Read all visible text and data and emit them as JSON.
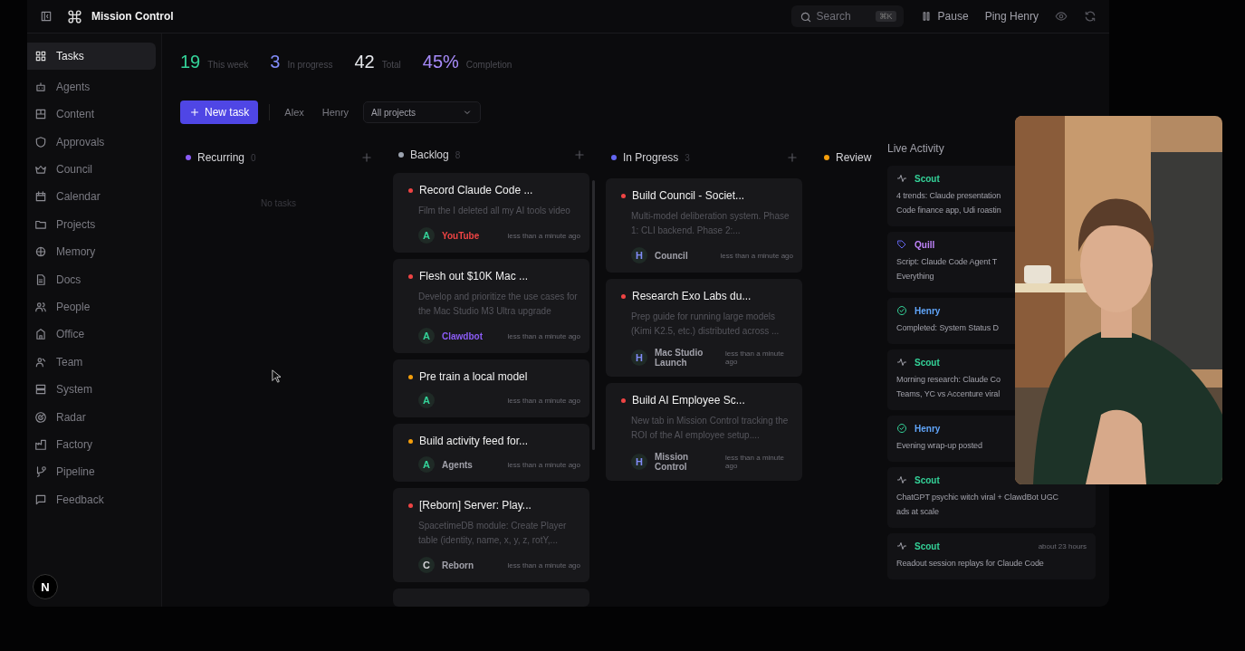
{
  "window": {
    "title": "Mission Control"
  },
  "topbar": {
    "search_placeholder": "Search",
    "search_shortcut": "⌘K",
    "pause": "Pause",
    "ping": "Ping Henry"
  },
  "sidebar": {
    "items": [
      {
        "label": "Tasks",
        "selected": true
      },
      {
        "label": "Agents",
        "selected": false
      },
      {
        "label": "Content",
        "selected": false
      },
      {
        "label": "Approvals",
        "selected": false
      },
      {
        "label": "Council",
        "selected": false
      },
      {
        "label": "Calendar",
        "selected": false
      },
      {
        "label": "Projects",
        "selected": false
      },
      {
        "label": "Memory",
        "selected": false
      },
      {
        "label": "Docs",
        "selected": false
      },
      {
        "label": "People",
        "selected": false
      },
      {
        "label": "Office",
        "selected": false
      },
      {
        "label": "Team",
        "selected": false
      },
      {
        "label": "System",
        "selected": false
      },
      {
        "label": "Radar",
        "selected": false
      },
      {
        "label": "Factory",
        "selected": false
      },
      {
        "label": "Pipeline",
        "selected": false
      },
      {
        "label": "Feedback",
        "selected": false
      }
    ],
    "logo": "N"
  },
  "stats": [
    {
      "value": "19",
      "label": "This week",
      "color": "#34d399"
    },
    {
      "value": "3",
      "label": "In progress",
      "color": "#818cf8"
    },
    {
      "value": "42",
      "label": "Total",
      "color": "#e5e7eb"
    },
    {
      "value": "45%",
      "label": "Completion",
      "color": "#a78bfa"
    }
  ],
  "toolbar": {
    "new_task": "New task",
    "filters": [
      {
        "label": "Alex",
        "selected": false
      },
      {
        "label": "Henry",
        "selected": false
      }
    ],
    "project_select": "All projects"
  },
  "columns": [
    {
      "title": "Recurring",
      "count": "0",
      "color": "#8b5cf6",
      "add": true,
      "empty_text": "No tasks"
    },
    {
      "title": "Backlog",
      "count": "8",
      "color": "#9ca3af",
      "add": true,
      "more": true,
      "cards": [
        {
          "title": "Record Claude Code ...",
          "priority": {
            "color": "#ef4444"
          },
          "description": "Film the I deleted all my AI tools video",
          "avatar": {
            "letter": "A",
            "color": "#34d399"
          },
          "tag": {
            "label": "YouTube",
            "color": "#ef4444"
          },
          "time": "less than a minute ago"
        },
        {
          "title": "Flesh out $10K Mac ...",
          "priority": {
            "color": "#ef4444"
          },
          "description": "Develop and prioritize the use cases for the Mac Studio M3 Ultra upgrade",
          "avatar": {
            "letter": "A",
            "color": "#34d399"
          },
          "tag": {
            "label": "Clawdbot",
            "color": "#8b5cf6"
          },
          "time": "less than a minute ago"
        },
        {
          "title": "Pre train a local model",
          "priority": {
            "color": "#f59e0b"
          },
          "avatar": {
            "letter": "A",
            "color": "#34d399"
          },
          "time": "less than a minute ago"
        },
        {
          "title": "Build activity feed for...",
          "priority": {
            "color": "#f59e0b"
          },
          "avatar": {
            "letter": "A",
            "color": "#34d399"
          },
          "tag": {
            "label": "Agents",
            "color": "#a1a1aa"
          },
          "time": "less than a minute ago"
        },
        {
          "title": "[Reborn] Server: Play...",
          "priority": {
            "color": "#ef4444"
          },
          "description": "SpacetimeDB module: Create Player table (identity, name, x, y, z, rotY,...",
          "avatar": {
            "letter": "C",
            "color": "#d4d4d8"
          },
          "tag": {
            "label": "Reborn",
            "color": "#a1a1aa"
          },
          "time": "less than a minute ago"
        }
      ]
    },
    {
      "title": "In Progress",
      "count": "3",
      "color": "#6366f1",
      "add": true,
      "cards": [
        {
          "title": "Build Council - Societ...",
          "priority": {
            "color": "#ef4444"
          },
          "description": "Multi-model deliberation system. Phase 1: CLI backend. Phase 2:...",
          "avatar": {
            "letter": "H",
            "color": "#818cf8"
          },
          "tag": {
            "label": "Council",
            "color": "#a1a1aa"
          },
          "time": "less than a minute ago"
        },
        {
          "title": "Research Exo Labs du...",
          "priority": {
            "color": "#ef4444"
          },
          "description": "Prep guide for running large models (Kimi K2.5, etc.) distributed across ...",
          "avatar": {
            "letter": "H",
            "color": "#818cf8"
          },
          "tag": {
            "label": "Mac Studio Launch",
            "color": "#a1a1aa"
          },
          "time": "less than a minute ago"
        },
        {
          "title": "Build AI Employee Sc...",
          "priority": {
            "color": "#ef4444"
          },
          "description": "New tab in Mission Control tracking the ROI of the AI employee setup....",
          "avatar": {
            "letter": "H",
            "color": "#818cf8"
          },
          "tag": {
            "label": "Mission Control",
            "color": "#a1a1aa"
          },
          "time": "less than a minute ago"
        }
      ]
    },
    {
      "title": "Review",
      "color": "#f59e0b",
      "add": false
    }
  ],
  "live_activity": {
    "title": "Live Activity",
    "items": [
      {
        "kind": "trend",
        "agent": "Scout",
        "color": "#34d399",
        "text": "4 trends: Claude presentation\nCode finance app, Udi roastin"
      },
      {
        "kind": "script",
        "agent": "Quill",
        "color": "#c084fc",
        "text": "Script: Claude Code Agent T\nEverything"
      },
      {
        "kind": "done",
        "agent": "Henry",
        "color": "#60a5fa",
        "text": "Completed: System Status D"
      },
      {
        "kind": "trend",
        "agent": "Scout",
        "color": "#34d399",
        "text": "Morning research: Claude Co\nTeams, YC vs Accenture viral"
      },
      {
        "kind": "done",
        "agent": "Henry",
        "color": "#60a5fa",
        "text": "Evening wrap-up posted"
      },
      {
        "kind": "trend",
        "agent": "Scout",
        "color": "#34d399",
        "text": "ChatGPT psychic witch viral + ClawdBot UGC\nads at scale"
      },
      {
        "kind": "trend",
        "agent": "Scout",
        "color": "#34d399",
        "time": "about 23 hours",
        "text": "Readout session replays for Claude Code"
      }
    ]
  }
}
